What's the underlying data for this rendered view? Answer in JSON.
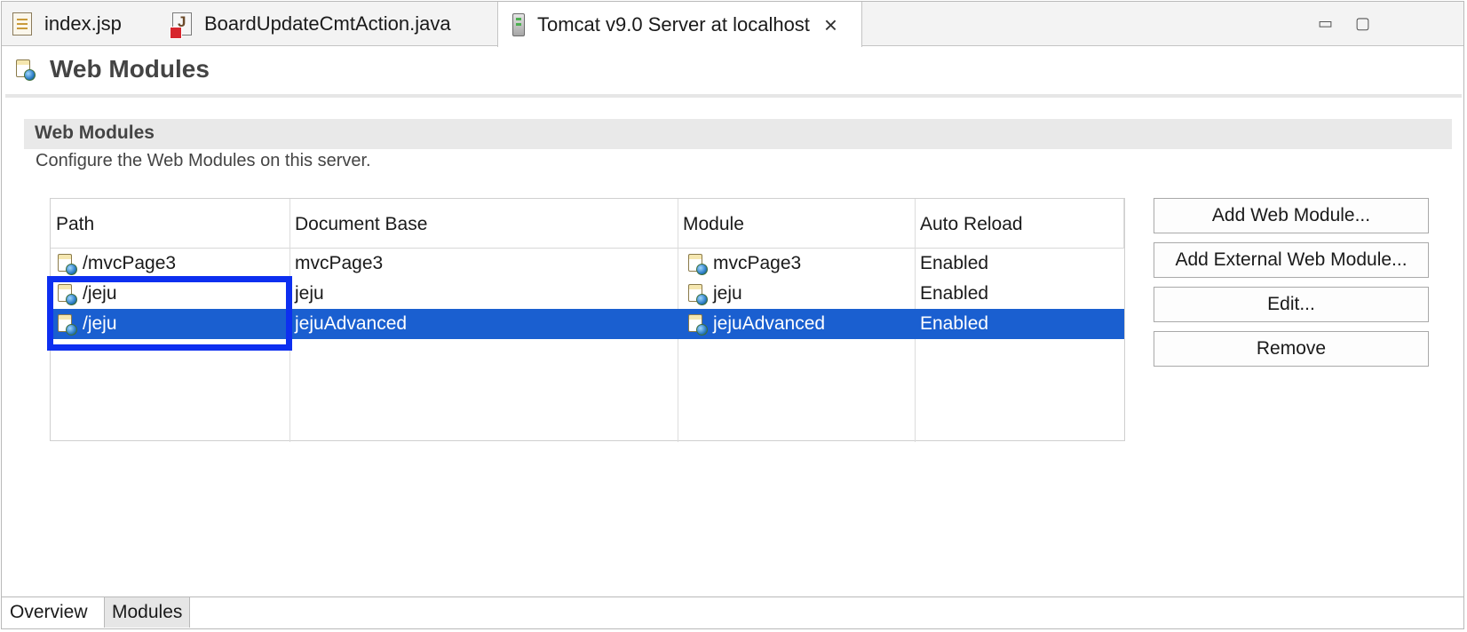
{
  "tabs": [
    {
      "label": "index.jsp",
      "icon": "jsp-file-icon"
    },
    {
      "label": "BoardUpdateCmtAction.java",
      "icon": "java-file-error-icon"
    },
    {
      "label": "Tomcat v9.0 Server at localhost",
      "icon": "tomcat-server-icon",
      "active": true
    }
  ],
  "window_controls": {
    "minimize": "▭",
    "maximize": "▢"
  },
  "header": {
    "title": "Web Modules"
  },
  "section": {
    "title": "Web Modules",
    "description": "Configure the Web Modules on this server."
  },
  "table": {
    "columns": [
      "Path",
      "Document Base",
      "Module",
      "Auto Reload"
    ],
    "rows": [
      {
        "path": "/mvcPage3",
        "document_base": "mvcPage3",
        "module": "mvcPage3",
        "auto_reload": "Enabled",
        "selected": false
      },
      {
        "path": "/jeju",
        "document_base": "jeju",
        "module": "jeju",
        "auto_reload": "Enabled",
        "selected": false
      },
      {
        "path": "/jeju",
        "document_base": "jejuAdvanced",
        "module": "jejuAdvanced",
        "auto_reload": "Enabled",
        "selected": true
      }
    ]
  },
  "buttons": {
    "add": "Add Web Module...",
    "add_external": "Add External Web Module...",
    "edit": "Edit...",
    "remove": "Remove"
  },
  "bottom_tabs": [
    {
      "label": "Overview",
      "active": false
    },
    {
      "label": "Modules",
      "active": true
    }
  ],
  "colors": {
    "selection": "#1a5fd0",
    "highlight_box": "#0d2ff0"
  }
}
